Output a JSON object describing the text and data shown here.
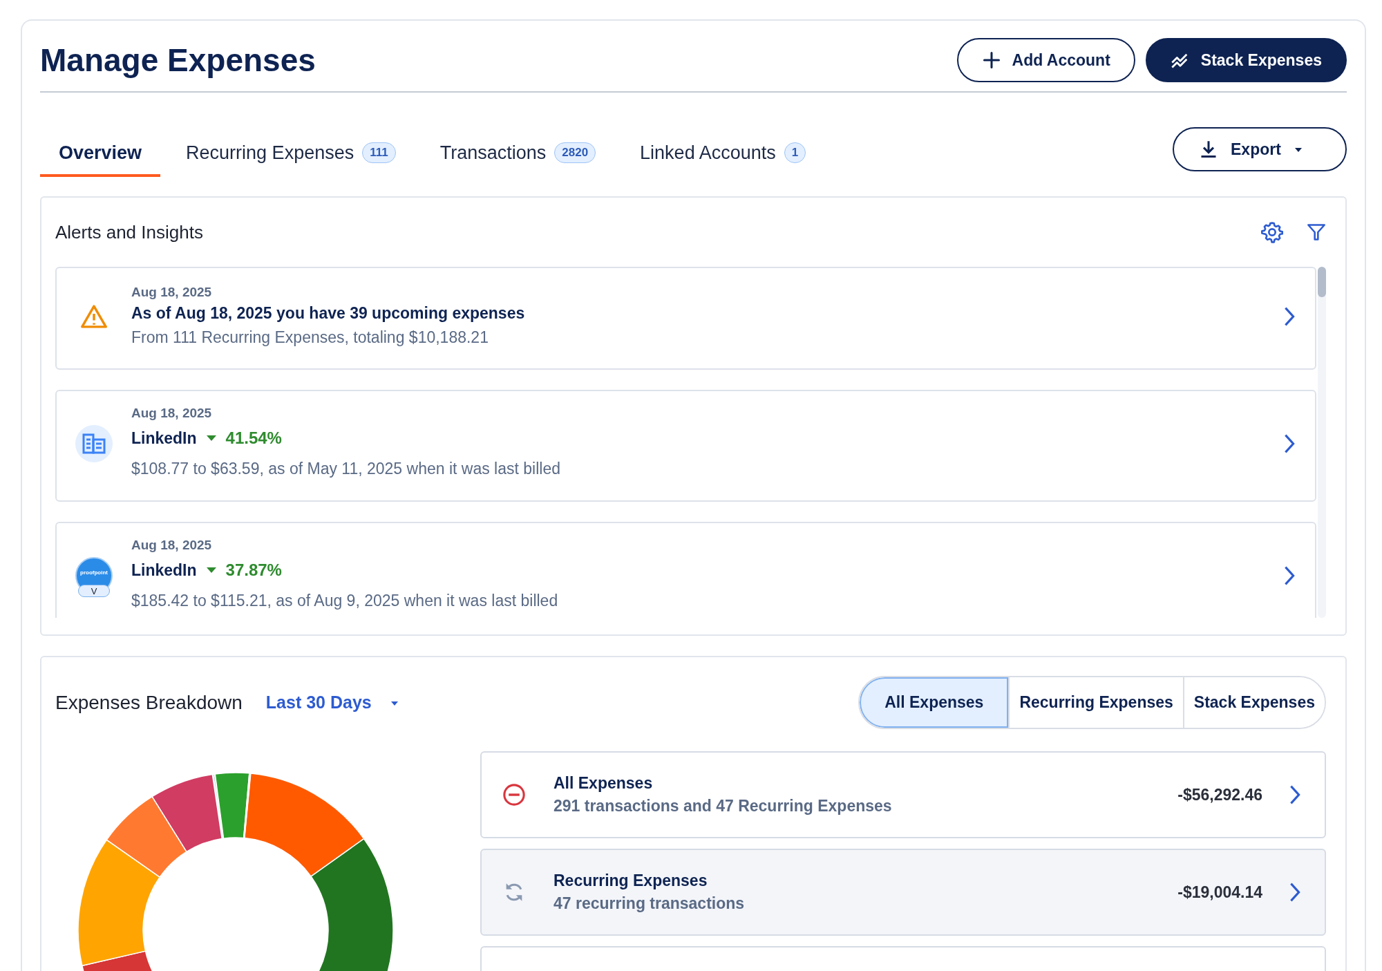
{
  "header": {
    "title": "Manage Expenses",
    "buttons": [
      {
        "kind": "outline",
        "label": "Add Account"
      },
      {
        "kind": "primary",
        "label": "Stack Expenses"
      }
    ]
  },
  "tabs": [
    {
      "label": "Overview",
      "selected": true
    },
    {
      "label": "Recurring Expenses",
      "count": "111",
      "selected": false
    },
    {
      "label": "Transactions",
      "count": "2820",
      "selected": false
    },
    {
      "label": "Linked Accounts",
      "count": "1",
      "selected": false
    }
  ],
  "export_button": {
    "label": "Export"
  },
  "alerts": {
    "title": "Alerts and Insights",
    "items": [
      {
        "kind": "warning",
        "date": "Aug 18, 2025",
        "title": "As of Aug 18, 2025 you have 39 upcoming expenses",
        "detail": "From 111 Recurring Expenses, totaling $10,188.21"
      },
      {
        "kind": "price_change",
        "date": "Aug 18, 2025",
        "title": "LinkedIn",
        "decrease": true,
        "change": "41.54%",
        "detail": "$108.77 to $63.59, as of May 11, 2025 when it was last billed"
      },
      {
        "kind": "price_change",
        "date": "Aug 18, 2025",
        "title": "LinkedIn",
        "logo_text": "proofpoint",
        "logo_badge": "V",
        "decrease": true,
        "change": "37.87%",
        "detail": "$185.42 to $115.21, as of Aug 9, 2025 when it was last billed"
      }
    ]
  },
  "breakdown": {
    "title": "Expenses Breakdown",
    "period": "Last 30 Days",
    "filters": [
      {
        "label": "All Expenses",
        "selected": true
      },
      {
        "label": "Recurring Expenses",
        "selected": false
      },
      {
        "label": "Stack Expenses",
        "selected": false
      }
    ],
    "rows": [
      {
        "kind": "all",
        "title": "All Expenses",
        "detail": "291 transactions and 47 Recurring Expenses",
        "amount": "-$56,292.46",
        "highlighted": false
      },
      {
        "kind": "recurring",
        "title": "Recurring Expenses",
        "detail": "47 recurring transactions",
        "amount": "-$19,004.14",
        "highlighted": true
      },
      {
        "kind": "clipped",
        "highlighted": false
      }
    ]
  }
}
